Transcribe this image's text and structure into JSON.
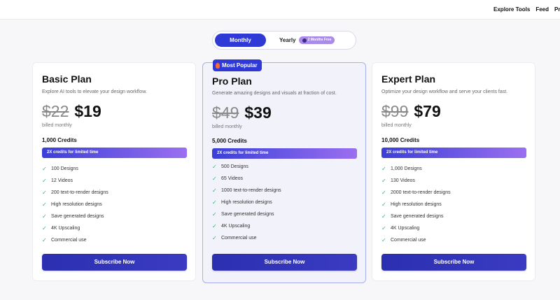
{
  "nav": {
    "explore": "Explore Tools",
    "feed": "Feed",
    "pricing": "Pri"
  },
  "toggle": {
    "monthly": "Monthly",
    "yearly": "Yearly",
    "free_badge": "2 Months Free"
  },
  "colors": {
    "accent": "#2f3ad6",
    "check": "#2bb673"
  },
  "plans": [
    {
      "name": "Basic Plan",
      "desc": "Explore AI tools to elevate your design workflow.",
      "old_price": "$22",
      "price": "$19",
      "billed": "billed monthly",
      "credits": "1,000 Credits",
      "promo": "2X credits for limited time",
      "features": [
        "100 Designs",
        "12 Videos",
        "200 text-to-render designs",
        "High resolution designs",
        "Save generated designs",
        "4K Upscaling",
        "Commercial use"
      ],
      "cta": "Subscribe Now"
    },
    {
      "name": "Pro Plan",
      "badge": "Most Popular",
      "desc": "Generate amazing designs and visuals at fraction of cost.",
      "old_price": "$49",
      "price": "$39",
      "billed": "billed monthly",
      "credits": "5,000 Credits",
      "promo": "2X credits for limited time",
      "features": [
        "500 Designs",
        "65 Videos",
        "1000 text-to-render designs",
        "High resolution designs",
        "Save generated designs",
        "4K Upscaling",
        "Commercial use"
      ],
      "cta": "Subscribe Now"
    },
    {
      "name": "Expert Plan",
      "desc": "Optimize your design workflow and serve your clients fast.",
      "old_price": "$99",
      "price": "$79",
      "billed": "billed monthly",
      "credits": "10,000 Credits",
      "promo": "2X credits for limited time",
      "features": [
        "1,000 Designs",
        "130 Videos",
        "2000 text-to-render designs",
        "High resolution designs",
        "Save generated designs",
        "4K Upscaling",
        "Commercial use"
      ],
      "cta": "Subscribe Now"
    }
  ]
}
